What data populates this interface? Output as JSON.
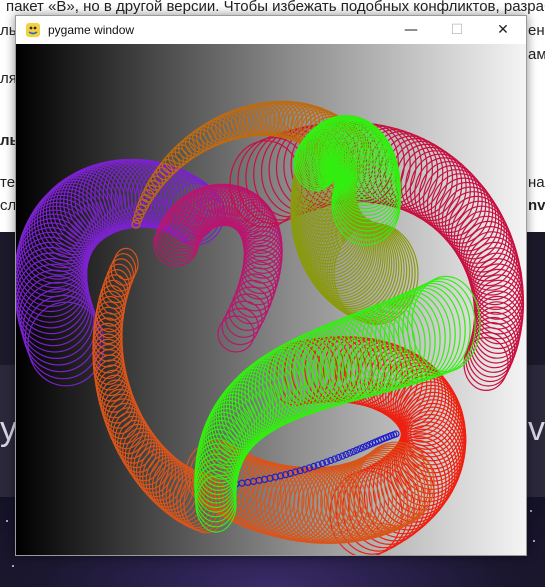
{
  "background_page": {
    "line1": "пакет «B», но в другой версии. Чтобы избежать подобных конфликтов, разраб",
    "line2_left": "ль",
    "line2_right": "ени",
    "line3_right": "ам",
    "line4_left": "ля",
    "line5_left": "лы",
    "line6_left": "те",
    "line6_right": "на",
    "line7_left": "сл",
    "line7_right": "nv",
    "big_left": "у",
    "big_right": "v"
  },
  "window": {
    "title": "pygame window",
    "controls": {
      "minimize": "—",
      "maximize": "☐",
      "close": "✕"
    }
  },
  "canvas": {
    "gradient": [
      "#000000",
      "#f4f4f4"
    ],
    "tube_colors": {
      "purple": "#7a22cc",
      "magenta": "#b8166f",
      "crimson": "#c81040",
      "orange": "#d9551a",
      "ochre": "#c06a10",
      "olive": "#8a9a10",
      "green": "#33ee10",
      "red": "#ee2010",
      "blue": "#2020cc"
    }
  }
}
